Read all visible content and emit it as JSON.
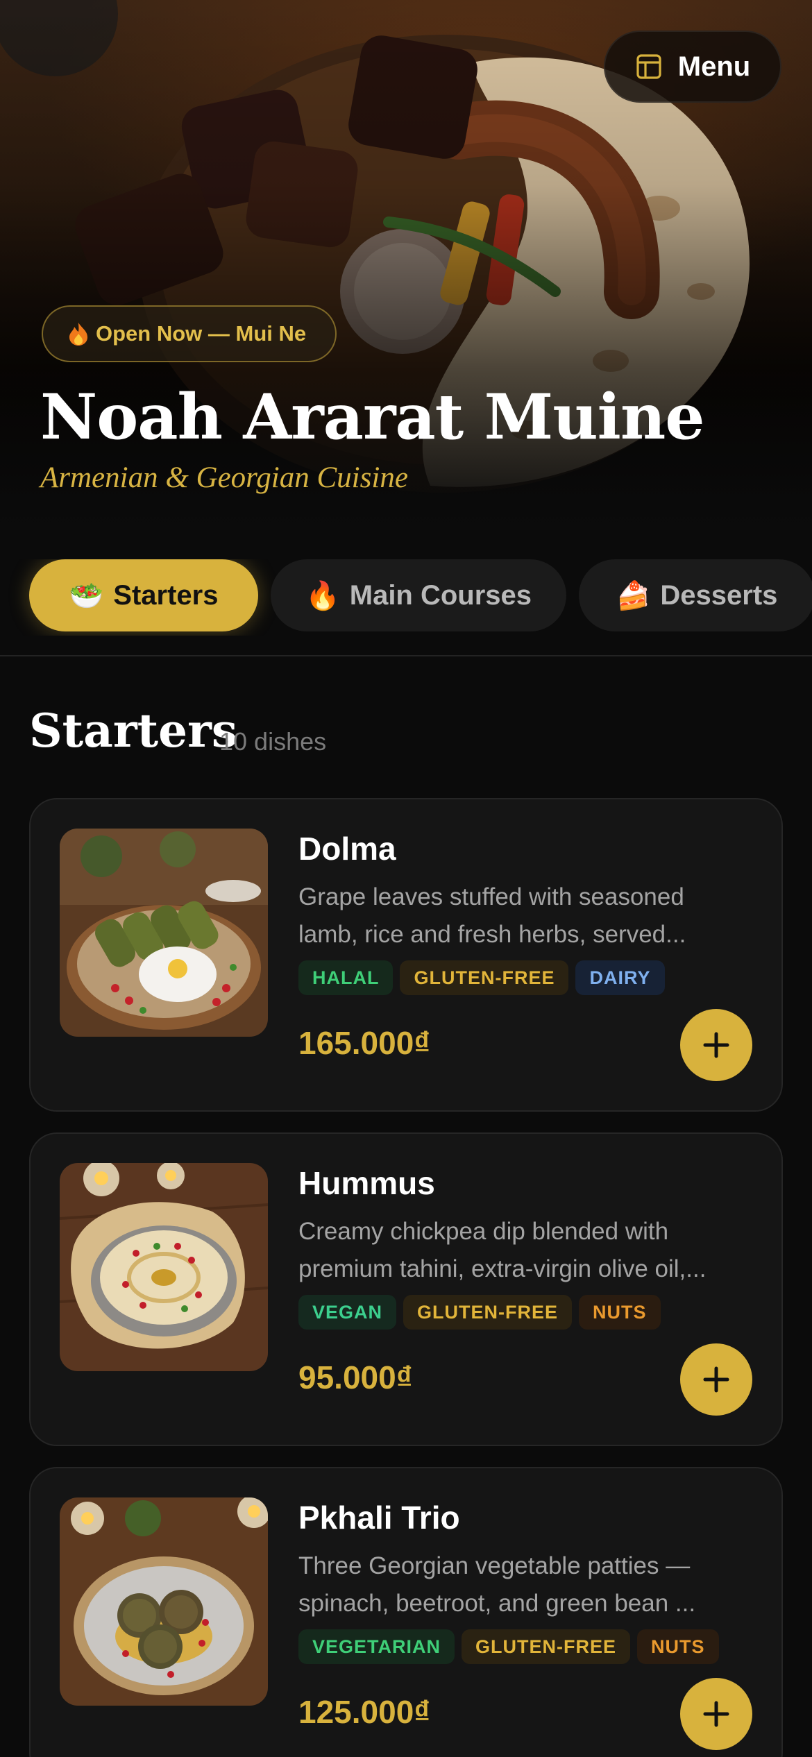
{
  "header": {
    "menu_label": "Menu",
    "menu_icon": "menu-book-icon",
    "status_badge": "Open Now — Mui Ne",
    "status_icon": "fire-emoji",
    "restaurant_name": "Noah Ararat Muine",
    "cuisine": "Armenian & Georgian Cuisine"
  },
  "tabs": [
    {
      "emoji": "🥗",
      "label": "Starters",
      "active": true
    },
    {
      "emoji": "🔥",
      "label": "Main Courses",
      "active": false
    },
    {
      "emoji": "🍰",
      "label": "Desserts",
      "active": false
    }
  ],
  "section": {
    "title": "Starters",
    "count": "10 dishes"
  },
  "dishes": [
    {
      "name": "Dolma",
      "desc_line1": "Grape leaves stuffed with seasoned",
      "desc_line2": "lamb, rice and fresh herbs, served...",
      "tags": [
        {
          "label": "HALAL",
          "style": "green"
        },
        {
          "label": "GLUTEN-FREE",
          "style": "gold"
        },
        {
          "label": "DAIRY",
          "style": "blue"
        }
      ],
      "price": "165.000₫"
    },
    {
      "name": "Hummus",
      "desc_line1": "Creamy chickpea dip blended with",
      "desc_line2": "premium tahini, extra-virgin olive oil,...",
      "tags": [
        {
          "label": "VEGAN",
          "style": "teal"
        },
        {
          "label": "GLUTEN-FREE",
          "style": "gold"
        },
        {
          "label": "NUTS",
          "style": "orange"
        }
      ],
      "price": "95.000₫"
    },
    {
      "name": "Pkhali Trio",
      "desc_line1": "Three Georgian vegetable patties —",
      "desc_line2": "spinach, beetroot, and green bean ...",
      "tags": [
        {
          "label": "VEGETARIAN",
          "style": "green"
        },
        {
          "label": "GLUTEN-FREE",
          "style": "gold"
        },
        {
          "label": "NUTS",
          "style": "orange"
        }
      ],
      "price": "125.000₫"
    }
  ],
  "colors": {
    "accent": "#d8b23d",
    "background": "#0b0b0b",
    "card": "#151515"
  }
}
